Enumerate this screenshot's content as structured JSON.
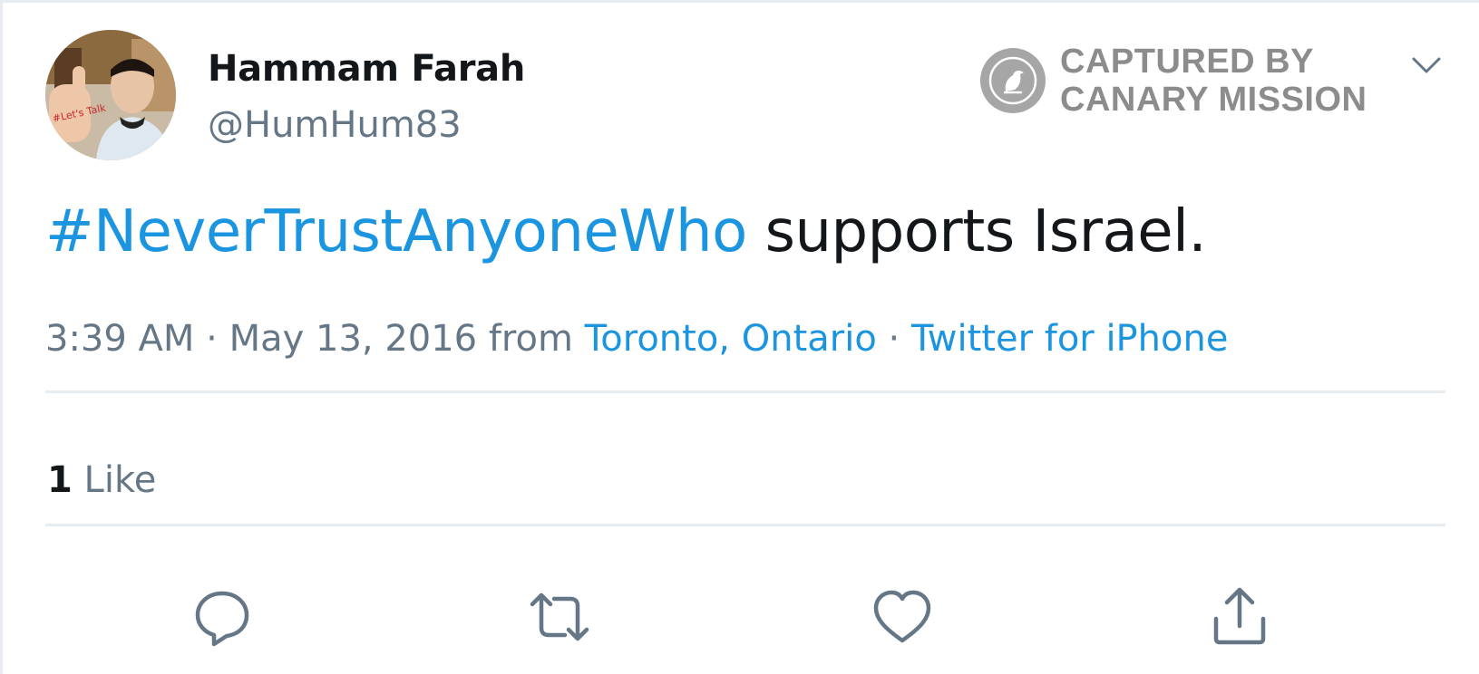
{
  "author": {
    "name": "Hammam Farah",
    "handle": "@HumHum83",
    "avatar_sign_text": "#Let's Talk"
  },
  "badge": {
    "line1": "CAPTURED BY",
    "line2": "CANARY MISSION",
    "icon": "canary-bird-icon",
    "color": "#8c8c8c"
  },
  "menu": {
    "icon": "chevron-down-icon"
  },
  "tweet": {
    "hashtag": "#NeverTrustAnyoneWho",
    "text": " supports Israel."
  },
  "meta": {
    "time": "3:39 AM",
    "separator1": " · ",
    "date": "May 13, 2016",
    "from_word": " from ",
    "location": "Toronto, Ontario",
    "separator2": " · ",
    "source": "Twitter for iPhone"
  },
  "engagement": {
    "like_count": "1",
    "like_label": " Like"
  },
  "actions": [
    {
      "name": "reply",
      "icon": "reply-icon"
    },
    {
      "name": "retweet",
      "icon": "retweet-icon"
    },
    {
      "name": "like",
      "icon": "heart-icon"
    },
    {
      "name": "share",
      "icon": "share-icon"
    }
  ],
  "colors": {
    "link": "#1b95e0",
    "secondary_text": "#657786",
    "primary_text": "#14171a",
    "divider": "#e6ecf0"
  }
}
